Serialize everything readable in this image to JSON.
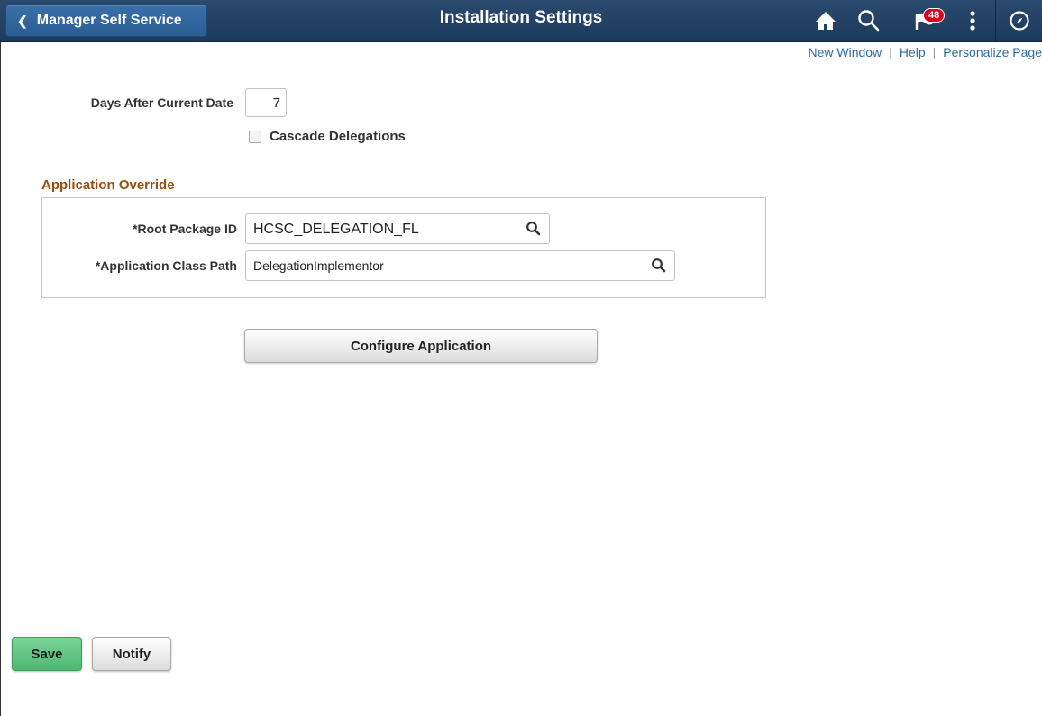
{
  "header": {
    "back_label": "Manager Self Service",
    "title": "Installation Settings",
    "notification_count": "48",
    "icons": [
      "chevron-left-icon",
      "home-icon",
      "search-icon",
      "flag-icon",
      "actions-menu-icon",
      "navbar-compass-icon"
    ],
    "colors": {
      "banner": "#1c3a5c",
      "badge": "#d9001b"
    }
  },
  "links": {
    "new_window": "New Window",
    "separator": "|",
    "help": "Help",
    "personalize": "Personalize Page"
  },
  "form": {
    "days_label": "Days After Current Date",
    "days_value": "7",
    "cascade_label": "Cascade Delegations",
    "cascade_checked": false,
    "section_title": "Application Override",
    "root_package_label": "*Root Package ID",
    "root_package_value": "HCSC_DELEGATION_FL",
    "class_path_label": "*Application Class Path",
    "class_path_value": "DelegationImplementor",
    "configure_label": "Configure Application"
  },
  "footer": {
    "save_label": "Save",
    "notify_label": "Notify",
    "colors": {
      "save": "#4fb872"
    }
  }
}
